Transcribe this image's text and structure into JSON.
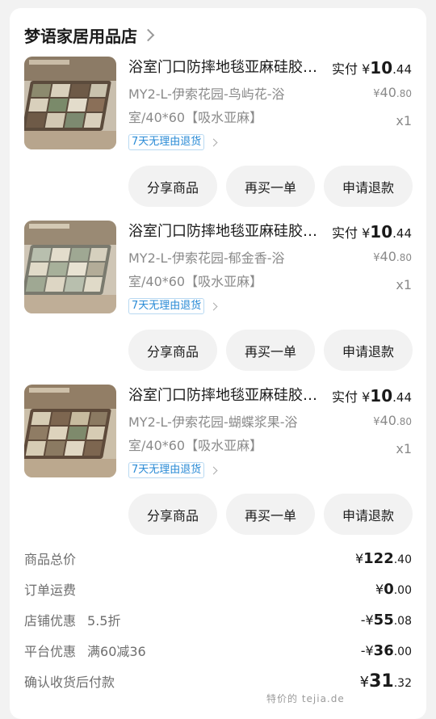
{
  "store": {
    "name": "梦语家居用品店"
  },
  "items": [
    {
      "title": "浴室门口防摔地毯亚麻硅胶吸水垫",
      "spec": "MY2-L-伊索花园-鸟屿花-浴室/40*60【吸水亚麻】",
      "paid_label": "实付",
      "paid_currency": "¥",
      "paid_int": "10",
      "paid_dec": ".44",
      "orig_currency": "¥",
      "orig_int": "40",
      "orig_dec": ".80",
      "qty": "x1",
      "tag": "7天无理由退货",
      "buttons": {
        "share": "分享商品",
        "rebuy": "再买一单",
        "refund": "申请退款"
      }
    },
    {
      "title": "浴室门口防摔地毯亚麻硅胶吸水垫",
      "spec": "MY2-L-伊索花园-郁金香-浴室/40*60【吸水亚麻】",
      "paid_label": "实付",
      "paid_currency": "¥",
      "paid_int": "10",
      "paid_dec": ".44",
      "orig_currency": "¥",
      "orig_int": "40",
      "orig_dec": ".80",
      "qty": "x1",
      "tag": "7天无理由退货",
      "buttons": {
        "share": "分享商品",
        "rebuy": "再买一单",
        "refund": "申请退款"
      }
    },
    {
      "title": "浴室门口防摔地毯亚麻硅胶吸水垫",
      "spec": "MY2-L-伊索花园-蝴蝶浆果-浴室/40*60【吸水亚麻】",
      "paid_label": "实付",
      "paid_currency": "¥",
      "paid_int": "10",
      "paid_dec": ".44",
      "orig_currency": "¥",
      "orig_int": "40",
      "orig_dec": ".80",
      "qty": "x1",
      "tag": "7天无理由退货",
      "buttons": {
        "share": "分享商品",
        "rebuy": "再买一单",
        "refund": "申请退款"
      }
    }
  ],
  "summary": {
    "total_label": "商品总价",
    "total_cur": "¥",
    "total_int": "122",
    "total_dec": ".40",
    "shipping_label": "订单运费",
    "shipping_cur": "¥",
    "shipping_int": "0",
    "shipping_dec": ".00",
    "store_disc_label": "店铺优惠",
    "store_disc_sub": "5.5折",
    "store_disc_prefix": "-¥",
    "store_disc_int": "55",
    "store_disc_dec": ".08",
    "platform_disc_label": "平台优惠",
    "platform_disc_sub": "满60减36",
    "platform_disc_prefix": "-¥",
    "platform_disc_int": "36",
    "platform_disc_dec": ".00",
    "final_label": "确认收货后付款",
    "final_cur": "¥",
    "final_int": "31",
    "final_dec": ".32"
  },
  "watermark": "特价的 tejia.de",
  "colors": {
    "accent_blue": "#2a8bd6",
    "button_bg": "#f2f2f2",
    "page_bg": "#f2f2f2"
  }
}
